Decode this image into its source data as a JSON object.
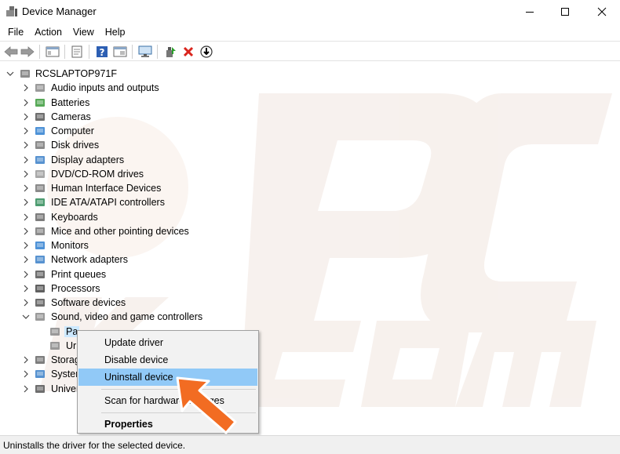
{
  "window": {
    "title": "Device Manager"
  },
  "menu": [
    "File",
    "Action",
    "View",
    "Help"
  ],
  "toolbar": {
    "icons": [
      "back-icon",
      "forward-icon",
      "show-hide-console-tree-icon",
      "properties-icon",
      "help-icon",
      "details-icon",
      "monitor-icon",
      "update-driver-icon",
      "uninstall-icon",
      "download-icon"
    ]
  },
  "tree": {
    "root": "RCSLAPTOP971F",
    "categories": [
      "Audio inputs and outputs",
      "Batteries",
      "Cameras",
      "Computer",
      "Disk drives",
      "Display adapters",
      "DVD/CD-ROM drives",
      "Human Interface Devices",
      "IDE ATA/ATAPI controllers",
      "Keyboards",
      "Mice and other pointing devices",
      "Monitors",
      "Network adapters",
      "Print queues",
      "Processors",
      "Software devices",
      "Sound, video and game controllers"
    ],
    "children": [
      "Pa",
      "Ur"
    ],
    "after": [
      "Storag",
      "Systen",
      "Univer"
    ]
  },
  "context_menu": {
    "items": [
      "Update driver",
      "Disable device",
      "Uninstall device",
      "Scan for hardware changes",
      "Properties"
    ],
    "highlighted": "Uninstall device"
  },
  "status": "Uninstalls the driver for the selected device.",
  "colors": {
    "highlight": "#91c9f7",
    "selection": "#cce8ff",
    "arrow": "#f26c22"
  }
}
